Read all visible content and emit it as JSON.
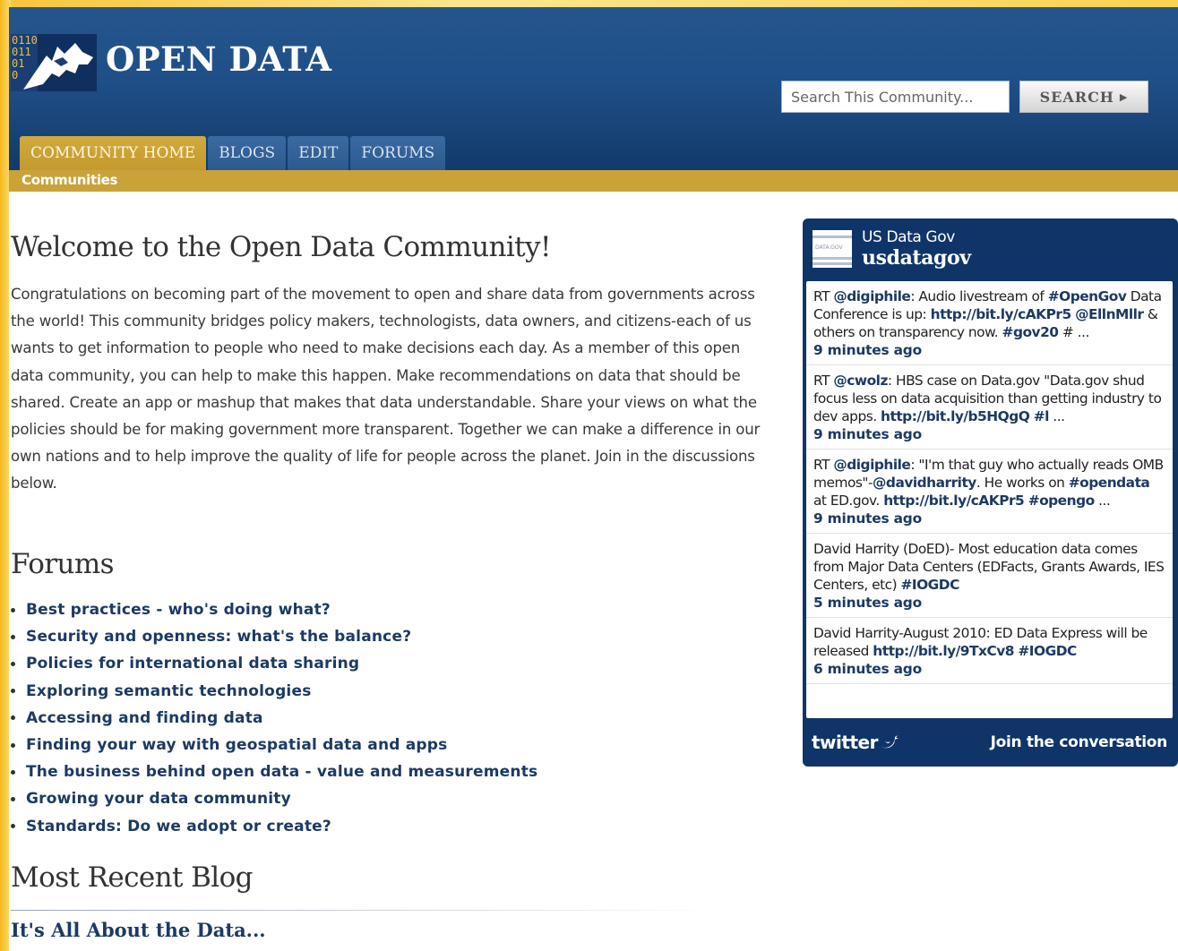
{
  "header": {
    "site_title": "OPEN DATA",
    "logo_binary": [
      "0110",
      "011",
      "01",
      "0"
    ],
    "search": {
      "placeholder": "Search This Community...",
      "button_label": "SEARCH"
    }
  },
  "nav": {
    "tabs": [
      {
        "label": "COMMUNITY HOME",
        "active": true
      },
      {
        "label": "BLOGS",
        "active": false
      },
      {
        "label": "EDIT",
        "active": false
      },
      {
        "label": "FORUMS",
        "active": false
      }
    ],
    "subnav_label": "Communities"
  },
  "main": {
    "welcome_title": "Welcome to the Open Data Community!",
    "welcome_text": "Congratulations on becoming part of the movement to open and share data from governments across the world! This community bridges policy makers, technologists, data owners, and citizens-each of us wants to get information to people who need to make decisions each day. As a member of this open data community, you can help to make this happen. Make recommendations on data that should be shared. Create an app or mashup that makes that data understandable. Share your views on what the policies should be for making government more transparent. Together we can make a difference in our own nations and to help improve the quality of life for people across the planet. Join in the discussions below.",
    "forums_title": "Forums",
    "forums": [
      "Best practices - who's doing what?",
      "Security and openness: what's the balance?",
      "Policies for international data sharing",
      "Exploring semantic technologies",
      "Accessing and finding data",
      "Finding your way with geospatial data and apps",
      "The business behind open data - value and measurements",
      "Growing your data community",
      "Standards: Do we adopt or create?"
    ],
    "blog_title": "Most Recent Blog",
    "blog_post": "It's All About the Data..."
  },
  "twitter": {
    "account_name": "US Data Gov",
    "handle": "usdatagov",
    "avatar_text": "DATA.GOV",
    "tweets": [
      {
        "parts": [
          {
            "t": "RT "
          },
          {
            "t": "@digiphile",
            "l": 1
          },
          {
            "t": ": Audio livestream of "
          },
          {
            "t": "#OpenGov",
            "l": 1
          },
          {
            "t": " Data Conference is up: "
          },
          {
            "t": "http://bit.ly/cAKPr5",
            "l": 1
          },
          {
            "t": " "
          },
          {
            "t": "@EllnMllr",
            "l": 1
          },
          {
            "t": " & others on transparency now. "
          },
          {
            "t": "#gov20",
            "l": 1
          },
          {
            "t": " # ..."
          }
        ],
        "time": "9 minutes ago"
      },
      {
        "parts": [
          {
            "t": "RT "
          },
          {
            "t": "@cwolz",
            "l": 1
          },
          {
            "t": ": HBS case on Data.gov \"Data.gov shud focus less on data acquisition than getting industry to dev apps. "
          },
          {
            "t": "http://bit.ly/b5HQgQ",
            "l": 1
          },
          {
            "t": " "
          },
          {
            "t": "#l",
            "l": 1
          },
          {
            "t": " ..."
          }
        ],
        "time": "9 minutes ago"
      },
      {
        "parts": [
          {
            "t": "RT "
          },
          {
            "t": "@digiphile",
            "l": 1
          },
          {
            "t": ": \"I'm that guy who actually reads OMB memos\"-"
          },
          {
            "t": "@davidharrity",
            "l": 1
          },
          {
            "t": ". He works on "
          },
          {
            "t": "#opendata",
            "l": 1
          },
          {
            "t": " at ED.gov. "
          },
          {
            "t": "http://bit.ly/cAKPr5",
            "l": 1
          },
          {
            "t": " "
          },
          {
            "t": "#opengo",
            "l": 1
          },
          {
            "t": " ..."
          }
        ],
        "time": "9 minutes ago"
      },
      {
        "parts": [
          {
            "t": "David Harrity (DoED)- Most education data comes from Major Data Centers (EDFacts, Grants Awards, IES Centers, etc) "
          },
          {
            "t": "#IOGDC",
            "l": 1
          }
        ],
        "time": "5 minutes ago"
      },
      {
        "parts": [
          {
            "t": "David Harrity-August 2010: ED Data Express will be released "
          },
          {
            "t": "http://bit.ly/9TxCv8",
            "l": 1
          },
          {
            "t": " "
          },
          {
            "t": "#IOGDC",
            "l": 1
          }
        ],
        "time": "6 minutes ago"
      }
    ],
    "logo_label": "twitter",
    "join_label": "Join the conversation"
  },
  "colors": {
    "header_blue": "#1f4f88",
    "accent_gold": "#c9a23a",
    "link_navy": "#1c3a63",
    "widget_blue": "#0f3568"
  }
}
